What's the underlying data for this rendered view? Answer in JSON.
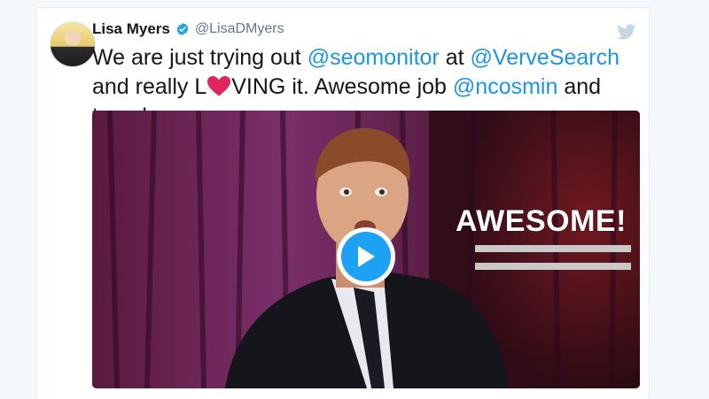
{
  "tweet": {
    "author_name": "Lisa Myers",
    "author_handle": "@LisaDMyers",
    "text": {
      "part1": "We are just trying out ",
      "mention1": "@seomonitor",
      "part2": " at ",
      "mention2": "@VerveSearch",
      "part3": " and really L",
      "part4": "VING it. Awesome job ",
      "mention3": "@ncosmin",
      "part5": " and team!"
    },
    "media": {
      "overlay_text": "AWESOME!",
      "type": "gif"
    }
  },
  "colors": {
    "mention": "#1b95e0",
    "verified": "#1da1f2",
    "play_button": "#1da1f2",
    "heart": "#e0245e",
    "bird": "#c9d7e2"
  },
  "icons": {
    "verified": "verified-badge-icon",
    "bird": "twitter-bird-icon",
    "heart": "heart-icon",
    "play": "play-icon"
  }
}
